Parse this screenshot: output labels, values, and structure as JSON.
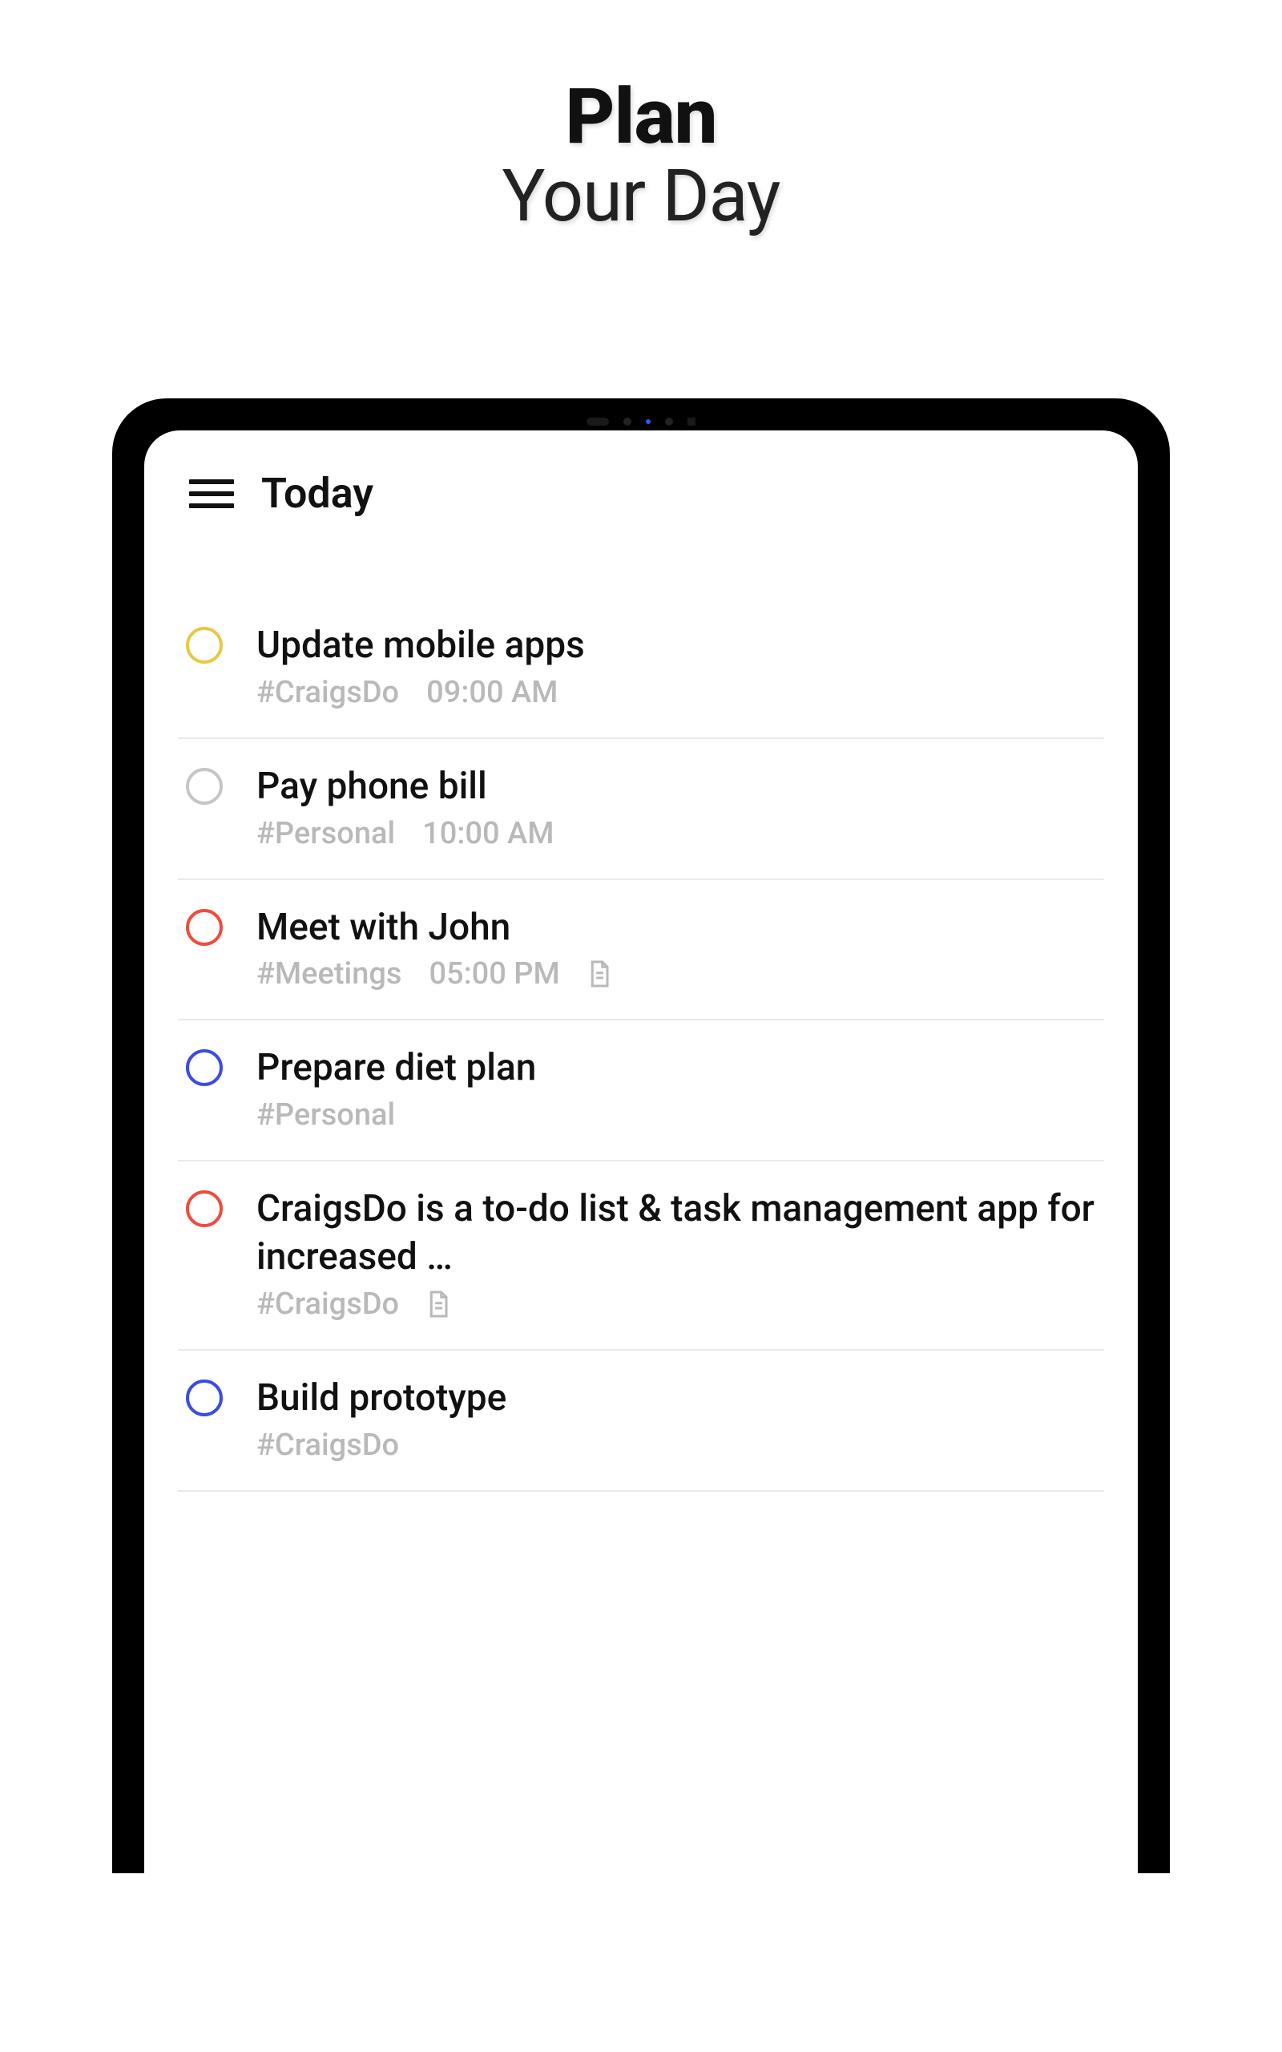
{
  "promo": {
    "line1": "Plan",
    "line2": "Your Day"
  },
  "header": {
    "title": "Today"
  },
  "colors": {
    "yellow": "#e6c947",
    "gray": "#c6c6c6",
    "red": "#f24a3d",
    "blue": "#3a4be8"
  },
  "tasks": [
    {
      "title": "Update mobile apps",
      "tag": "#CraigsDo",
      "time": "09:00 AM",
      "colorKey": "yellow",
      "hasNote": false
    },
    {
      "title": "Pay phone bill",
      "tag": "#Personal",
      "time": "10:00 AM",
      "colorKey": "gray",
      "hasNote": false
    },
    {
      "title": "Meet with John",
      "tag": "#Meetings",
      "time": "05:00 PM",
      "colorKey": "red",
      "hasNote": true
    },
    {
      "title": "Prepare diet plan",
      "tag": "#Personal",
      "time": "",
      "colorKey": "blue",
      "hasNote": false
    },
    {
      "title": "CraigsDo is a to-do list & task management app for increased …",
      "tag": "#CraigsDo",
      "time": "",
      "colorKey": "red",
      "hasNote": true
    },
    {
      "title": "Build prototype",
      "tag": "#CraigsDo",
      "time": "",
      "colorKey": "blue",
      "hasNote": false
    }
  ]
}
